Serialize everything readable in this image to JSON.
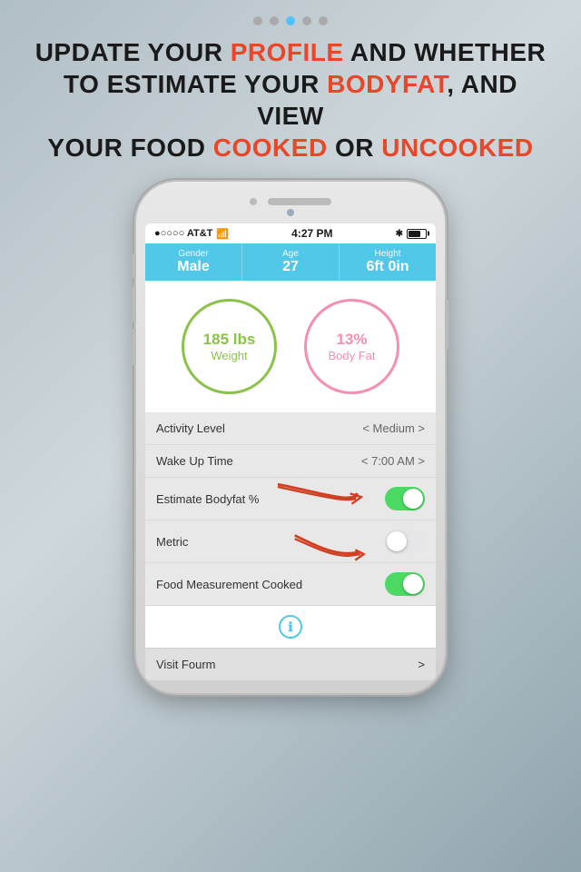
{
  "dots": [
    {
      "active": false
    },
    {
      "active": false
    },
    {
      "active": true
    },
    {
      "active": false
    },
    {
      "active": false
    }
  ],
  "headline": {
    "line1_before": "UPDATE YOUR ",
    "line1_accent": "PROFILE",
    "line1_after": " AND WHETHER",
    "line2": "TO ESTIMATE YOUR ",
    "line2_accent": "BODYFAT",
    "line2_after": ", AND VIEW",
    "line3_before": "YOUR FOOD ",
    "line3_accent1": "COOKED",
    "line3_between": " OR ",
    "line3_accent2": "UNCOOKED"
  },
  "status_bar": {
    "carrier": "●○○○○ AT&T",
    "wifi": "WiFi",
    "time": "4:27 PM",
    "bluetooth": "BT",
    "battery": "70%"
  },
  "profile": {
    "gender_label": "Gender",
    "gender_value": "Male",
    "age_label": "Age",
    "age_value": "27",
    "height_label": "Height",
    "height_value": "6ft 0in"
  },
  "weight_circle": {
    "value": "185 lbs",
    "label": "Weight"
  },
  "bodyfat_circle": {
    "value": "13%",
    "label": "Body Fat"
  },
  "settings": [
    {
      "label": "Activity Level",
      "value": "< Medium >",
      "type": "select"
    },
    {
      "label": "Wake Up Time",
      "value": "< 7:00 AM >",
      "type": "select"
    },
    {
      "label": "Estimate Bodyfat %",
      "type": "toggle",
      "on": true
    },
    {
      "label": "Metric",
      "type": "toggle",
      "on": false
    },
    {
      "label": "Food Measurement Cooked",
      "type": "toggle",
      "on": true
    }
  ],
  "info_button": "ℹ",
  "forum_row": {
    "label": "Visit Fourm",
    "chevron": ">"
  }
}
